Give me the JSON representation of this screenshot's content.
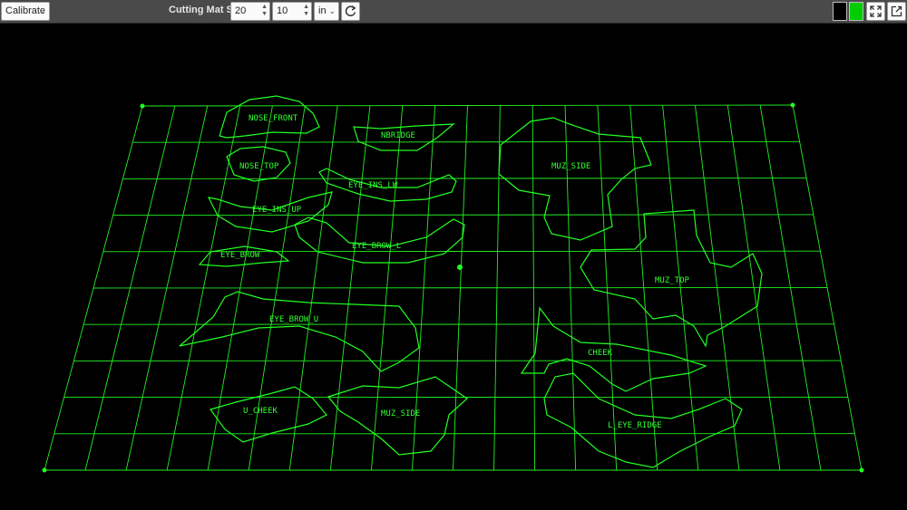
{
  "toolbar": {
    "mode_select": "Calibrate",
    "mat_size_label": "Cutting Mat Size",
    "width_value": "20",
    "height_value": "10",
    "unit_select": "in",
    "reset_icon": "refresh-icon",
    "bg_color": "#000000",
    "line_color": "#00cc00",
    "fullscreen_icon": "fullscreen-icon",
    "open_icon": "open-external-icon"
  },
  "projection": {
    "line_color": "#22ff22",
    "grid_cols": 20,
    "grid_rows": 10,
    "pieces": [
      {
        "label": "NOSE_FRONT"
      },
      {
        "label": "NBRIDGE"
      },
      {
        "label": "MUZ_SIDE"
      },
      {
        "label": "NOSE_TOP"
      },
      {
        "label": "EYE_INS_LW"
      },
      {
        "label": "EYE_INS_UP"
      },
      {
        "label": "EYE_BROW_L"
      },
      {
        "label": "EYE_BROW"
      },
      {
        "label": "MUZ_TOP"
      },
      {
        "label": "EYE_BROW_U"
      },
      {
        "label": "CHEEK"
      },
      {
        "label": "U_CHEEK"
      },
      {
        "label": "MUZ_SIDE"
      },
      {
        "label": "L_EYE_RIDGE"
      }
    ]
  }
}
